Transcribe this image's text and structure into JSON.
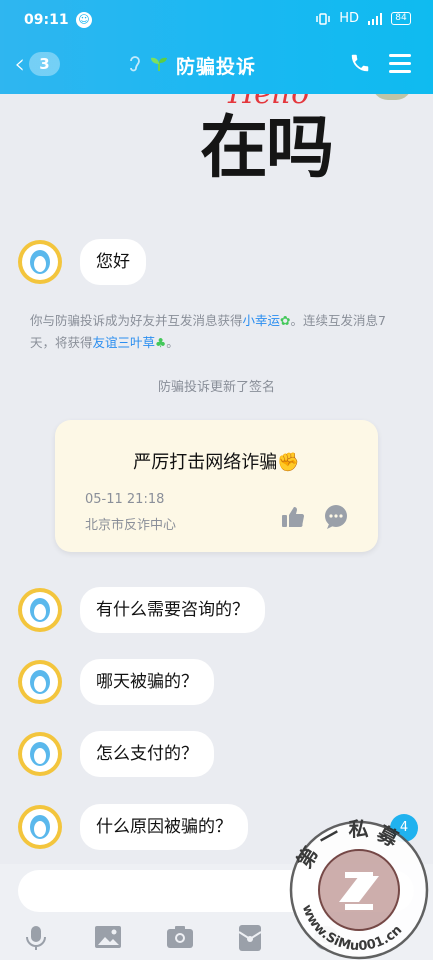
{
  "status_bar": {
    "time": "09:11",
    "network": "HD",
    "battery": "84"
  },
  "header": {
    "unread_count": "3",
    "title": "防骗投诉"
  },
  "sticker": {
    "hello_text": "Hello",
    "main_text": "在吗"
  },
  "messages": [
    {
      "text": "您好"
    },
    {
      "text": "有什么需要咨询的？"
    },
    {
      "text": "哪天被骗的？"
    },
    {
      "text": "怎么支付的？"
    },
    {
      "text": "什么原因被骗的？"
    }
  ],
  "friendship_notice": {
    "part1": "你与防骗投诉成为好友并互发消息获得",
    "link1": "小幸运",
    "part2": "。连续互发消息7天，将获得",
    "link2": "友谊三叶草",
    "part3": "。"
  },
  "signature_update": "防骗投诉更新了签名",
  "signature_card": {
    "text": "严厉打击网络诈骗",
    "date": "05-11 21:18",
    "location": "北京市反诈中心"
  },
  "new_message_badge": "4",
  "input": {
    "placeholder": ""
  },
  "watermark": {
    "text": "第一私募 www.SiMu001.cn"
  },
  "colors": {
    "header": "#1ab8f2",
    "link": "#2b8ef0",
    "avatar_yellow": "#f3c53d",
    "card_bg": "#fdf8e6"
  }
}
